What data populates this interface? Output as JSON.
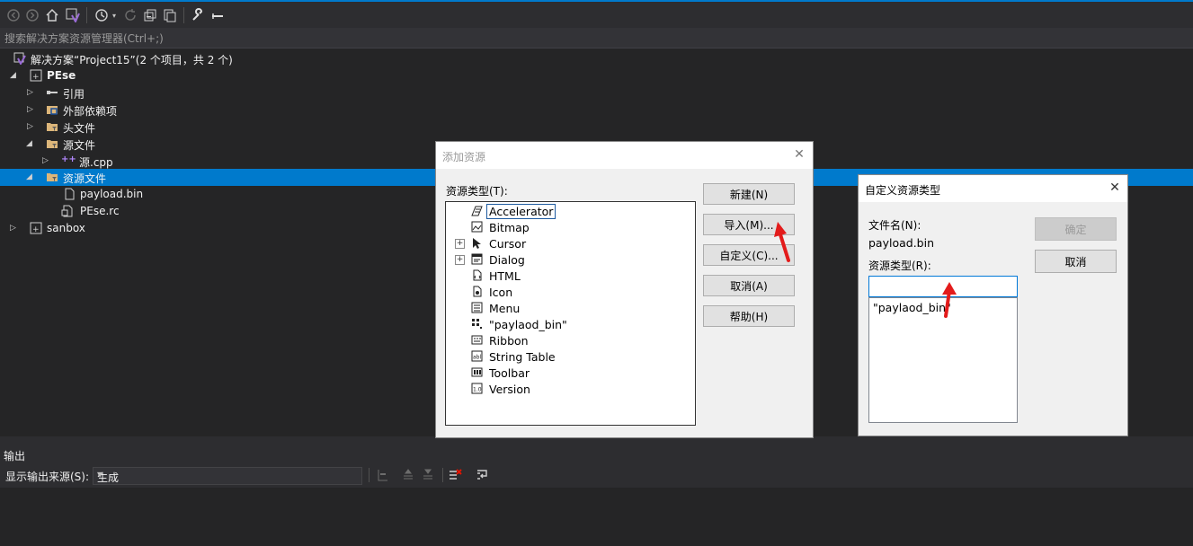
{
  "toolbar": {
    "icons": [
      "back-icon",
      "forward-icon",
      "home-icon",
      "vs-icon",
      "history-icon",
      "dropdown-icon",
      "refresh-icon",
      "collapse-icon",
      "copy-icon",
      "wrench-icon",
      "minus-icon"
    ]
  },
  "search": {
    "placeholder": "搜索解决方案资源管理器(Ctrl+;)"
  },
  "solution_explorer": {
    "solution": "解决方案“Project15”(2 个项目，共 2 个)",
    "items": [
      {
        "label": "PEse",
        "bold": true
      },
      {
        "label": "引用"
      },
      {
        "label": "外部依赖项"
      },
      {
        "label": "头文件"
      },
      {
        "label": "源文件"
      },
      {
        "label": "源.cpp"
      },
      {
        "label": "资源文件",
        "selected": true
      },
      {
        "label": "payload.bin"
      },
      {
        "label": "PEse.rc"
      },
      {
        "label": "sanbox",
        "bold": true
      }
    ]
  },
  "output": {
    "title": "输出",
    "source_label": "显示输出来源(S):",
    "source_value": "生成"
  },
  "add_resource_dialog": {
    "title": "添加资源",
    "type_label": "资源类型(T):",
    "resource_types": [
      {
        "label": "Accelerator",
        "icon": "accelerator-icon",
        "focused": true
      },
      {
        "label": "Bitmap",
        "icon": "bitmap-icon"
      },
      {
        "label": "Cursor",
        "icon": "cursor-icon",
        "expandable": true
      },
      {
        "label": "Dialog",
        "icon": "dialog-icon",
        "expandable": true
      },
      {
        "label": "HTML",
        "icon": "html-icon"
      },
      {
        "label": "Icon",
        "icon": "icon-resource-icon"
      },
      {
        "label": "Menu",
        "icon": "menu-icon"
      },
      {
        "label": "\"paylaod_bin\"",
        "icon": "custom-resource-icon"
      },
      {
        "label": "Ribbon",
        "icon": "ribbon-icon"
      },
      {
        "label": "String Table",
        "icon": "string-table-icon"
      },
      {
        "label": "Toolbar",
        "icon": "toolbar-icon"
      },
      {
        "label": "Version",
        "icon": "version-icon"
      }
    ],
    "buttons": {
      "new": "新建(N)",
      "import": "导入(M)...",
      "custom": "自定义(C)...",
      "cancel": "取消(A)",
      "help": "帮助(H)"
    }
  },
  "custom_resource_dialog": {
    "title": "自定义资源类型",
    "filename_label": "文件名(N):",
    "filename_value": "payload.bin",
    "type_label": "资源类型(R):",
    "type_input_value": "",
    "type_options": [
      "\"paylaod_bin\""
    ],
    "buttons": {
      "ok": "确定",
      "cancel": "取消"
    }
  },
  "colors": {
    "accent": "#007acc",
    "arrow_red": "#e31b1b"
  }
}
